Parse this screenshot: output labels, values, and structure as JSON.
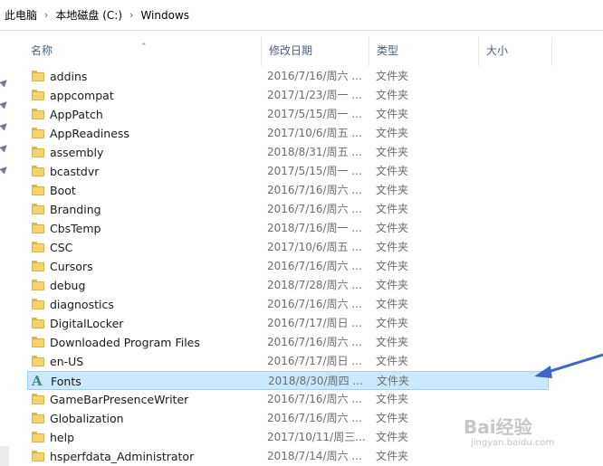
{
  "breadcrumb": [
    "此电脑",
    "本地磁盘 (C:)",
    "Windows"
  ],
  "columns": {
    "name": "名称",
    "date": "修改日期",
    "type": "类型",
    "size": "大小"
  },
  "rows": [
    {
      "name": "addins",
      "date": "2016/7/16/周六 ...",
      "type": "文件夹",
      "icon": "folder-icon"
    },
    {
      "name": "appcompat",
      "date": "2017/1/23/周一 ...",
      "type": "文件夹",
      "icon": "folder-icon"
    },
    {
      "name": "AppPatch",
      "date": "2017/5/15/周一 ...",
      "type": "文件夹",
      "icon": "folder-icon"
    },
    {
      "name": "AppReadiness",
      "date": "2017/10/6/周五 ...",
      "type": "文件夹",
      "icon": "folder-icon"
    },
    {
      "name": "assembly",
      "date": "2018/8/31/周五 ...",
      "type": "文件夹",
      "icon": "folder-icon"
    },
    {
      "name": "bcastdvr",
      "date": "2017/5/15/周一 ...",
      "type": "文件夹",
      "icon": "folder-icon"
    },
    {
      "name": "Boot",
      "date": "2016/7/16/周六 ...",
      "type": "文件夹",
      "icon": "folder-icon"
    },
    {
      "name": "Branding",
      "date": "2016/7/16/周六 ...",
      "type": "文件夹",
      "icon": "folder-icon"
    },
    {
      "name": "CbsTemp",
      "date": "2018/7/16/周一 ...",
      "type": "文件夹",
      "icon": "folder-icon"
    },
    {
      "name": "CSC",
      "date": "2017/10/6/周五 ...",
      "type": "文件夹",
      "icon": "folder-icon"
    },
    {
      "name": "Cursors",
      "date": "2016/7/16/周六 ...",
      "type": "文件夹",
      "icon": "folder-icon"
    },
    {
      "name": "debug",
      "date": "2018/7/28/周六 ...",
      "type": "文件夹",
      "icon": "folder-icon"
    },
    {
      "name": "diagnostics",
      "date": "2016/7/16/周六 ...",
      "type": "文件夹",
      "icon": "folder-icon"
    },
    {
      "name": "DigitalLocker",
      "date": "2016/7/17/周日 ...",
      "type": "文件夹",
      "icon": "folder-icon"
    },
    {
      "name": "Downloaded Program Files",
      "date": "2016/7/16/周六 ...",
      "type": "文件夹",
      "icon": "folder-icon"
    },
    {
      "name": "en-US",
      "date": "2016/7/17/周日 ...",
      "type": "文件夹",
      "icon": "folder-icon"
    },
    {
      "name": "Fonts",
      "date": "2018/8/30/周四 ...",
      "type": "文件夹",
      "icon": "font-folder-icon",
      "selected": true
    },
    {
      "name": "GameBarPresenceWriter",
      "date": "2016/7/16/周六 ...",
      "type": "文件夹",
      "icon": "folder-icon"
    },
    {
      "name": "Globalization",
      "date": "2016/7/16/周六 ...",
      "type": "文件夹",
      "icon": "folder-icon"
    },
    {
      "name": "help",
      "date": "2017/10/11/周三...",
      "type": "文件夹",
      "icon": "folder-icon"
    },
    {
      "name": "hsperfdata_Administrator",
      "date": "2018/7/14/周六 ...",
      "type": "文件夹",
      "icon": "folder-icon"
    }
  ],
  "watermark": {
    "brand": "Bai经验",
    "url": "jingyan.baidu.com"
  }
}
